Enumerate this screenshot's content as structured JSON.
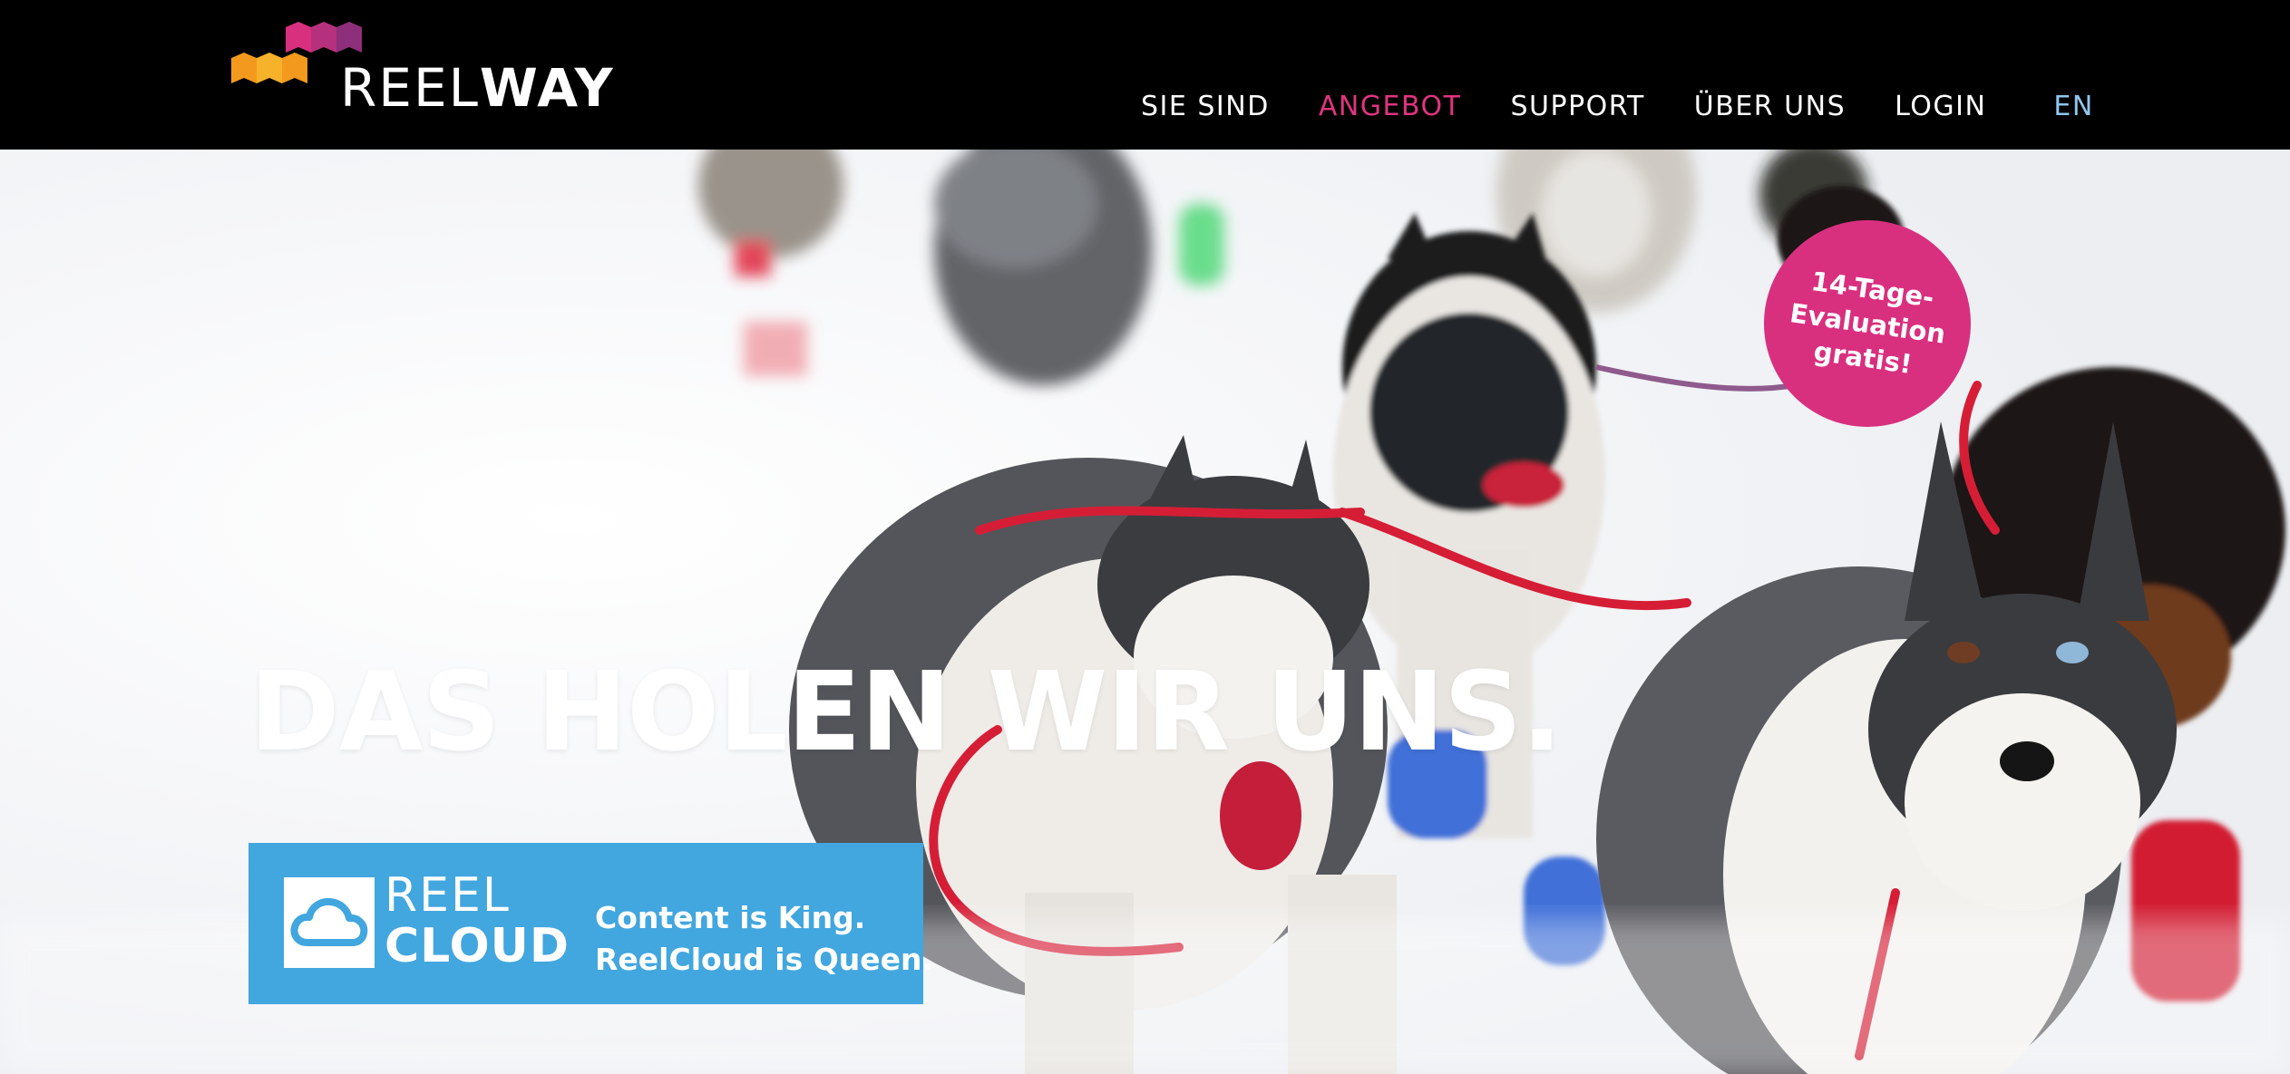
{
  "header": {
    "logo": {
      "text_light": "REEL",
      "text_bold": "WAY"
    },
    "nav": [
      {
        "label": "SIE SIND"
      },
      {
        "label": "ANGEBOT"
      },
      {
        "label": "SUPPORT"
      },
      {
        "label": "ÜBER UNS"
      },
      {
        "label": "LOGIN"
      }
    ],
    "language": "EN"
  },
  "hero": {
    "headline": "DAS HOLEN WIR UNS.",
    "reelcloud": {
      "name_line1": "REEL",
      "name_line2": "CLOUD",
      "tagline_line1": "Content is King.",
      "tagline_line2": "ReelCloud is Queen."
    },
    "badge": {
      "line1": "14-Tage-",
      "line2": "Evaluation",
      "line3": "gratis!"
    },
    "image": "sled-dogs-huskies-running-in-snow"
  },
  "colors": {
    "header_bg": "#000000",
    "nav_text": "#ffffff",
    "nav_active": "#e0347f",
    "lang": "#8fc6ee",
    "badge": "#d92f7f",
    "reelcloud_bg": "#42a6df",
    "logo_orange": "#f39a1e",
    "logo_pink": "#d92f7f"
  },
  "icons": [
    "reelway-logo-mark",
    "cloud-icon"
  ]
}
